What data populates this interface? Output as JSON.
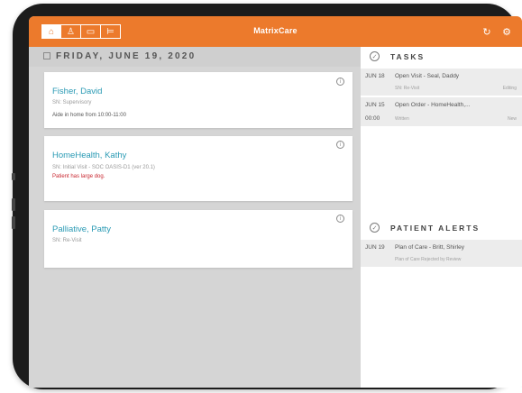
{
  "header": {
    "brand": "MatrixCare",
    "nav_tabs": [
      "home-icon",
      "person-icon",
      "calendar-icon",
      "bed-icon"
    ],
    "accent": "#ec7a2c"
  },
  "schedule": {
    "date": "FRIDAY, JUNE 19, 2020",
    "visits": [
      {
        "name": "Fisher, David",
        "type": "SN: Supervisory",
        "note": "Aide in home from 10:00-11:00"
      },
      {
        "name": "HomeHealth, Kathy",
        "type": "SN: Initial Visit - SOC OASIS-D1 (ver 20.1)",
        "note": "Patient has large dog."
      },
      {
        "name": "Palliative, Patty",
        "type": "SN: Re-Visit",
        "note": ""
      }
    ]
  },
  "tasks": {
    "title": "TASKS",
    "items": [
      {
        "date": "JUN 18",
        "title": "Open Visit - Seal, Daddy",
        "sub": "SN: Re-Visit",
        "status": "Editing"
      },
      {
        "date": "JUN 15",
        "title": "Open Order - HomeHealth,...",
        "time": "00:00",
        "sub": "Written",
        "status": "New"
      }
    ]
  },
  "alerts": {
    "title": "PATIENT ALERTS",
    "items": [
      {
        "date": "JUN 19",
        "title": "Plan of Care - Britt, Shirley",
        "sub": "Plan of Care Rejected by Review"
      }
    ]
  }
}
